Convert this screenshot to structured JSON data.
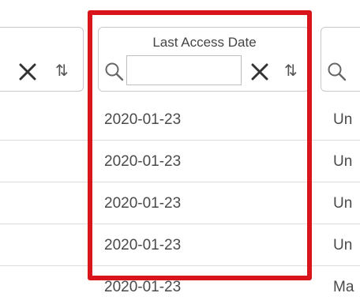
{
  "columns": {
    "left": {
      "rows": [
        "",
        "",
        "",
        "",
        ""
      ]
    },
    "main": {
      "title": "Last Access Date",
      "search": {
        "value": "",
        "placeholder": ""
      },
      "rows": [
        "2020-01-23",
        "2020-01-23",
        "2020-01-23",
        "2020-01-23",
        "2020-01-23"
      ]
    },
    "right": {
      "rows": [
        "Un",
        "Un",
        "Un",
        "Un",
        "Ma"
      ]
    }
  },
  "highlight_color": "#d9141b",
  "icons": {
    "search": "search-icon",
    "clear": "close-icon",
    "sort": "sort-icon"
  }
}
